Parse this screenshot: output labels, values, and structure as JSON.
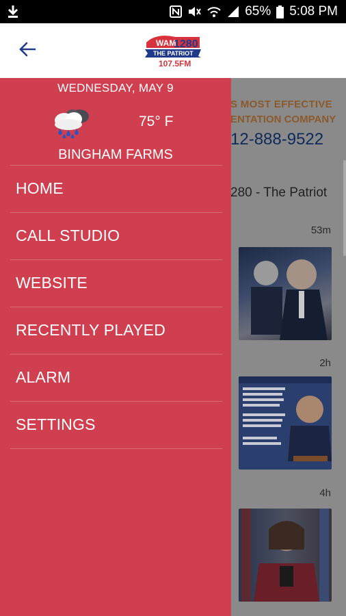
{
  "status_bar": {
    "battery": "65%",
    "time": "5:08 PM"
  },
  "app_bar": {
    "logo": {
      "text_top": "WAM",
      "text_main": "1280",
      "text_band": "THE PATRIOT",
      "text_fm": "107.5FM"
    }
  },
  "drawer": {
    "date": "WEDNESDAY, MAY 9",
    "weather_icon": "rain-cloud-icon",
    "temperature": "75° F",
    "location": "BINGHAM FARMS",
    "menu": [
      {
        "label": "HOME"
      },
      {
        "label": "CALL STUDIO"
      },
      {
        "label": "WEBSITE"
      },
      {
        "label": "RECENTLY PLAYED"
      },
      {
        "label": "ALARM"
      },
      {
        "label": "SETTINGS"
      }
    ]
  },
  "background": {
    "ad_line1": "S MOST EFFECTIVE",
    "ad_line2": "ENTATION COMPANY",
    "ad_phone": "12-888-9522",
    "station_title": "280 - The Patriot",
    "feed": [
      {
        "time": "53m",
        "thumb": "kerry-photo"
      },
      {
        "time": "2h",
        "thumb": "north-korea-release-graphic"
      },
      {
        "time": "4h",
        "thumb": "pelosi-photo"
      }
    ]
  },
  "colors": {
    "drawer": "#cf3f4f",
    "status_bar": "#000000",
    "app_bar": "#ffffff",
    "back_arrow": "#1f3a8a"
  }
}
